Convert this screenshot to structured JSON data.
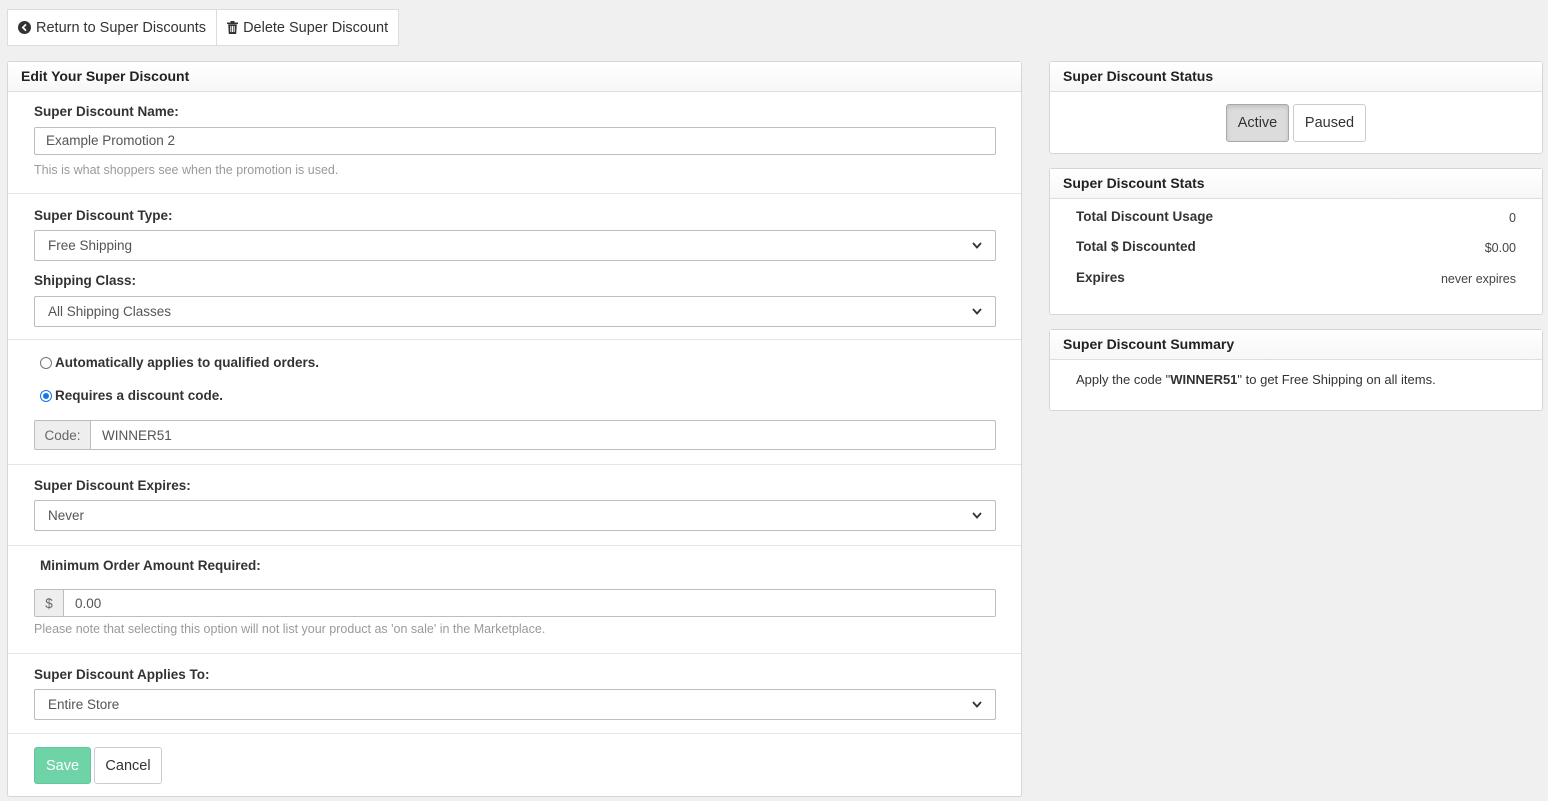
{
  "toolbar": {
    "return_label": "Return to Super Discounts",
    "delete_label": "Delete Super Discount"
  },
  "edit_panel": {
    "title": "Edit Your Super Discount",
    "name_label": "Super Discount Name:",
    "name_value": "Example Promotion 2",
    "name_help": "This is what shoppers see when the promotion is used.",
    "type_label": "Super Discount Type:",
    "type_value": "Free Shipping",
    "shipping_class_label": "Shipping Class:",
    "shipping_class_value": "All Shipping Classes",
    "radio_auto_label": "Automatically applies to qualified orders.",
    "radio_auto_checked": false,
    "radio_code_label": "Requires a discount code.",
    "radio_code_checked": true,
    "code_addon": "Code:",
    "code_value": "WINNER51",
    "expires_label": "Super Discount Expires:",
    "expires_value": "Never",
    "min_order_label": "Minimum Order Amount Required:",
    "min_order_addon": "$",
    "min_order_value": "0.00",
    "min_order_help": "Please note that selecting this option will not list your product as 'on sale' in the Marketplace.",
    "applies_label": "Super Discount Applies To:",
    "applies_value": "Entire Store",
    "save_label": "Save",
    "cancel_label": "Cancel"
  },
  "status_panel": {
    "title": "Super Discount Status",
    "active_label": "Active",
    "paused_label": "Paused",
    "selected": "Active"
  },
  "stats_panel": {
    "title": "Super Discount Stats",
    "rows": [
      {
        "label": "Total Discount Usage",
        "value": "0"
      },
      {
        "label": "Total $ Discounted",
        "value": "$0.00"
      },
      {
        "label": "Expires",
        "value": "never expires"
      }
    ]
  },
  "summary_panel": {
    "title": "Super Discount Summary",
    "text_before": "Apply the code \"",
    "code": "WINNER51",
    "text_after": "\" to get Free Shipping on all items."
  },
  "colors": {
    "save_button": "#6fd3a8",
    "radio_selected": "#1a73e8",
    "page_background": "#f0f0f0"
  }
}
